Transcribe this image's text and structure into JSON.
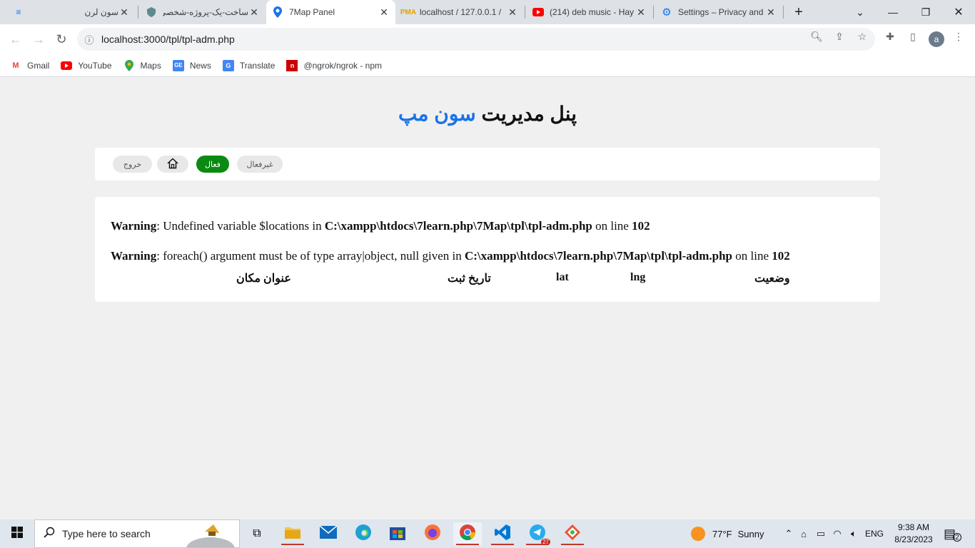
{
  "browser": {
    "tabs": [
      {
        "title": "سون لرن",
        "icon": "sevenlearn-icon"
      },
      {
        "title": "ساخت-یک-پروژه-شخصی",
        "icon": "shield-icon"
      },
      {
        "title": "7Map Panel",
        "icon": "map-pin-icon",
        "active": true
      },
      {
        "title": "localhost / 127.0.0.1 /",
        "icon": "phpmyadmin-icon"
      },
      {
        "title": "(214) deb music - Hay",
        "icon": "youtube-icon"
      },
      {
        "title": "Settings – Privacy and",
        "icon": "gear-icon"
      }
    ],
    "url": "localhost:3000/tpl/tpl-adm.php",
    "profile_initial": "a",
    "bookmarks": [
      {
        "label": "Gmail",
        "icon": "gmail-icon"
      },
      {
        "label": "YouTube",
        "icon": "youtube-icon"
      },
      {
        "label": "Maps",
        "icon": "maps-icon"
      },
      {
        "label": "News",
        "icon": "news-icon"
      },
      {
        "label": "Translate",
        "icon": "translate-icon"
      },
      {
        "label": "@ngrok/ngrok - npm",
        "icon": "npm-icon"
      }
    ]
  },
  "page": {
    "title_main": "پنل مدیریت",
    "title_accent": "سون مپ",
    "menu": {
      "inactive": "غیرفعال",
      "active": "فعال",
      "home_icon": "home-icon",
      "logout": "خروج"
    },
    "warnings": [
      {
        "label": "Warning",
        "message": ": Undefined variable $locations in ",
        "file": "C:\\xampp\\htdocs\\7learn.php\\7Map\\tpl\\tpl-adm.php",
        "on_line": " on line ",
        "line": "102"
      },
      {
        "label": "Warning",
        "message": ": foreach() argument must be of type array|object, null given in ",
        "file": "C:\\xampp\\htdocs\\7learn.php\\7Map\\tpl\\tpl-adm.php",
        "on_line": " on line ",
        "line": "102"
      }
    ],
    "table_headers": {
      "status": "وضعیت",
      "lng": "lng",
      "lat": "lat",
      "date": "تاریخ ثبت",
      "title": "عنوان مکان"
    }
  },
  "taskbar": {
    "search_placeholder": "Type here to search",
    "weather_temp": "77°F",
    "weather_text": "Sunny",
    "language": "ENG",
    "time": "9:38 AM",
    "date": "8/23/2023",
    "notification_count": "2",
    "telegram_badge": "27"
  }
}
